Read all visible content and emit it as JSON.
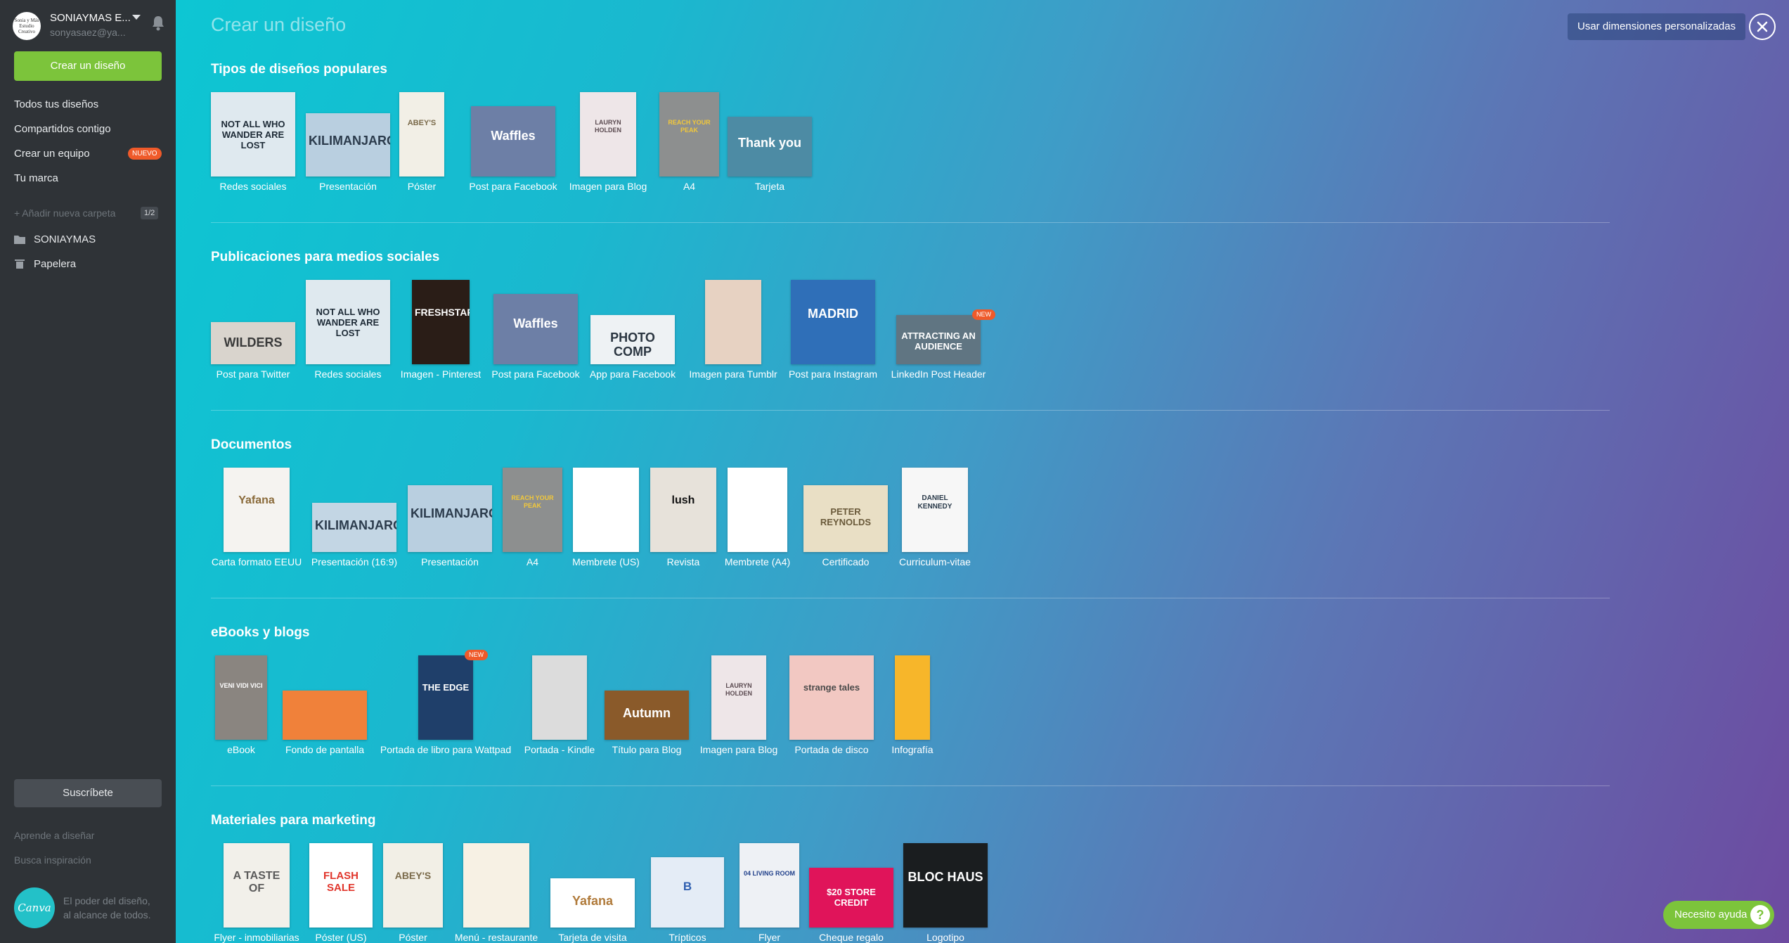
{
  "account": {
    "name": "SONIAYMAS E...",
    "email": "sonyasaez@ya...",
    "avatar_text": "Sonia y Más Estudio Creativo"
  },
  "sidebar": {
    "create_button": "Crear un diseño",
    "nav": [
      {
        "label": "Todos tus diseños"
      },
      {
        "label": "Compartidos contigo"
      },
      {
        "label": "Crear un equipo",
        "badge": "NUEVO"
      },
      {
        "label": "Tu marca"
      }
    ],
    "add_folder": "+ Añadir nueva carpeta",
    "folder_count": "1/2",
    "folders": [
      {
        "label": "SONIAYMAS",
        "icon": "folder-icon"
      },
      {
        "label": "Papelera",
        "icon": "trash-icon"
      }
    ],
    "subscribe_button": "Suscríbete",
    "links": [
      "Aprende a diseñar",
      "Busca inspiración"
    ],
    "logo_text": "Canva",
    "tagline_1": "El poder del diseño,",
    "tagline_2": "al alcance de todos."
  },
  "header": {
    "title": "Crear un diseño",
    "custom_dimensions": "Usar dimensiones personalizadas",
    "close_icon": "close-icon"
  },
  "sections": [
    {
      "title": "Tipos de diseños populares",
      "items": [
        {
          "label": "Redes sociales",
          "text": "NOT ALL WHO WANDER ARE LOST",
          "bg": "#dfe9ef",
          "fg": "#1d2a36"
        },
        {
          "label": "Presentación",
          "text": "KILIMANJARO",
          "bg": "#b9cfe0",
          "fg": "#2b3b4c"
        },
        {
          "label": "Póster",
          "text": "ABEY'S",
          "bg": "#f2efe6",
          "fg": "#7a6a4a"
        },
        {
          "label": "Post para Facebook",
          "text": "Waffles",
          "bg": "#6d7fa6",
          "fg": "#ffffff"
        },
        {
          "label": "Imagen para Blog",
          "text": "LAURYN HOLDEN",
          "bg": "#eee6e8",
          "fg": "#5a4a50"
        },
        {
          "label": "A4",
          "text": "REACH YOUR PEAK",
          "bg": "#8d8f8f",
          "fg": "#f2c83a"
        },
        {
          "label": "Tarjeta",
          "text": "Thank you",
          "bg": "#4d8ba4",
          "fg": "#ffffff"
        }
      ]
    },
    {
      "title": "Publicaciones para medios sociales",
      "items": [
        {
          "label": "Post para Twitter",
          "text": "WILDERS",
          "bg": "#d9d4cd",
          "fg": "#3a3a3a"
        },
        {
          "label": "Redes sociales",
          "text": "NOT ALL WHO WANDER ARE LOST",
          "bg": "#dfe9ef",
          "fg": "#1d2a36"
        },
        {
          "label": "Imagen - Pinterest",
          "text": "FRESHSTART",
          "bg": "#2a1d17",
          "fg": "#ffffff"
        },
        {
          "label": "Post para Facebook",
          "text": "Waffles",
          "bg": "#6d7fa6",
          "fg": "#ffffff"
        },
        {
          "label": "App para Facebook",
          "text": "PHOTO COMP",
          "bg": "#eef2f4",
          "fg": "#2a3540"
        },
        {
          "label": "Imagen para Tumblr",
          "text": "",
          "bg": "#e7d2c2",
          "fg": "#5a3a2a"
        },
        {
          "label": "Post para Instagram",
          "text": "MADRID",
          "bg": "#2f6fb8",
          "fg": "#ffffff"
        },
        {
          "label": "LinkedIn Post Header",
          "text": "ATTRACTING AN AUDIENCE",
          "bg": "#607582",
          "fg": "#ffffff",
          "badge": "NEW"
        }
      ]
    },
    {
      "title": "Documentos",
      "items": [
        {
          "label": "Carta formato EEUU",
          "text": "Yafana",
          "bg": "#f5f3f0",
          "fg": "#8a6a3a"
        },
        {
          "label": "Presentación (16:9)",
          "text": "KILIMANJARO",
          "bg": "#c3d6e4",
          "fg": "#2b3b4c"
        },
        {
          "label": "Presentación",
          "text": "KILIMANJARO",
          "bg": "#b9cfe0",
          "fg": "#2b3b4c"
        },
        {
          "label": "A4",
          "text": "REACH YOUR PEAK",
          "bg": "#8d8f8f",
          "fg": "#f2c83a"
        },
        {
          "label": "Membrete (US)",
          "text": "",
          "bg": "#ffffff",
          "fg": "#555555"
        },
        {
          "label": "Revista",
          "text": "lush",
          "bg": "#e7e2da",
          "fg": "#111111"
        },
        {
          "label": "Membrete (A4)",
          "text": "",
          "bg": "#ffffff",
          "fg": "#555555"
        },
        {
          "label": "Certificado",
          "text": "PETER REYNOLDS",
          "bg": "#e9dfc5",
          "fg": "#6a5a3a"
        },
        {
          "label": "Curriculum-vitae",
          "text": "DANIEL KENNEDY",
          "bg": "#f7f7f7",
          "fg": "#2a3a4a"
        }
      ]
    },
    {
      "title": "eBooks y blogs",
      "items": [
        {
          "label": "eBook",
          "text": "VENI VIDI VICI",
          "bg": "#8a8580",
          "fg": "#ffffff"
        },
        {
          "label": "Fondo de pantalla",
          "text": "",
          "bg": "#f0813a",
          "fg": "#ffffff"
        },
        {
          "label": "Portada de libro para Wattpad",
          "text": "THE EDGE",
          "bg": "#1f3f6a",
          "fg": "#ffffff",
          "badge": "NEW"
        },
        {
          "label": "Portada - Kindle",
          "text": "",
          "bg": "#dcdcdc",
          "fg": "#333333"
        },
        {
          "label": "Título para Blog",
          "text": "Autumn",
          "bg": "#8a5a2a",
          "fg": "#ffffff"
        },
        {
          "label": "Imagen para Blog",
          "text": "LAURYN HOLDEN",
          "bg": "#eee6e8",
          "fg": "#5a4a50"
        },
        {
          "label": "Portada de disco",
          "text": "strange tales",
          "bg": "#f2c8c2",
          "fg": "#4a4a4a"
        },
        {
          "label": "Infografía",
          "text": "",
          "bg": "#f7b62a",
          "fg": "#2a2a2a"
        }
      ]
    },
    {
      "title": "Materiales para marketing",
      "items": [
        {
          "label": "Flyer - inmobiliarias",
          "text": "A TASTE OF",
          "bg": "#f2f0ea",
          "fg": "#5a5a5a"
        },
        {
          "label": "Póster (US)",
          "text": "FLASH SALE",
          "bg": "#ffffff",
          "fg": "#e1352b"
        },
        {
          "label": "Póster",
          "text": "ABEY'S",
          "bg": "#f2efe6",
          "fg": "#7a6a4a"
        },
        {
          "label": "Menú - restaurante",
          "text": "",
          "bg": "#f7f1e4",
          "fg": "#6a5a4a"
        },
        {
          "label": "Tarjeta de visita",
          "text": "Yafana",
          "bg": "#ffffff",
          "fg": "#b07a3a"
        },
        {
          "label": "Trípticos",
          "text": "B",
          "bg": "#e4ecf6",
          "fg": "#2f5fb0"
        },
        {
          "label": "Flyer",
          "text": "04 LIVING ROOM",
          "bg": "#eef1f5",
          "fg": "#1f3f8a"
        },
        {
          "label": "Cheque regalo",
          "text": "$20 STORE CREDIT",
          "bg": "#e0145a",
          "fg": "#ffffff"
        },
        {
          "label": "Logotipo",
          "text": "BLOC HAUS",
          "bg": "#1a1d1f",
          "fg": "#ffffff"
        }
      ]
    }
  ],
  "help": {
    "label": "Necesito ayuda",
    "icon": "?"
  }
}
